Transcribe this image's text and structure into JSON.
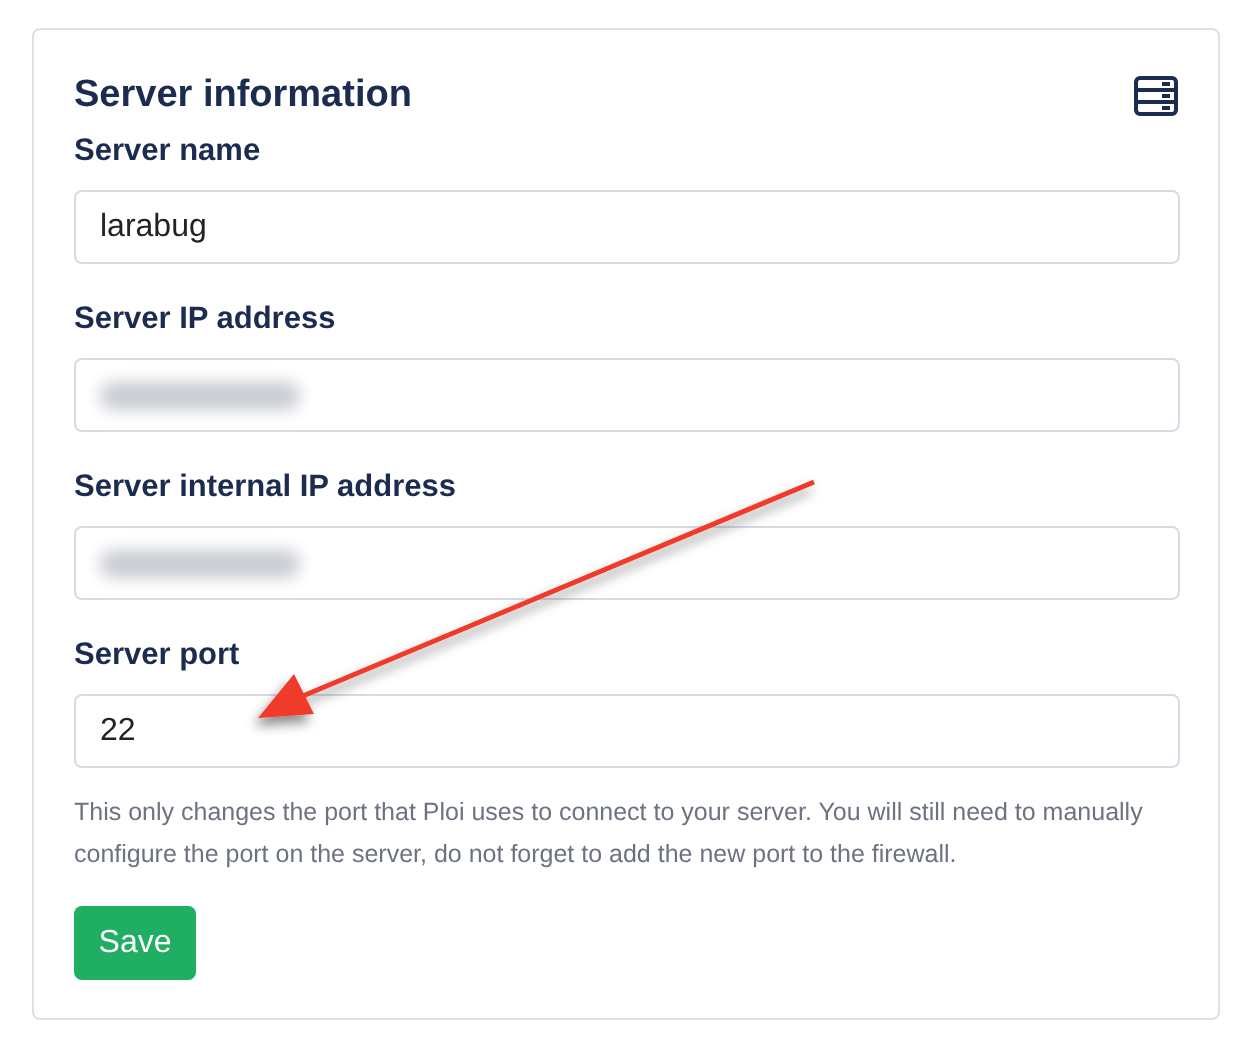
{
  "card": {
    "title": "Server information",
    "fields": [
      {
        "label": "Server name",
        "value": "larabug",
        "redacted": false
      },
      {
        "label": "Server IP address",
        "redacted": true
      },
      {
        "label": "Server internal IP address",
        "redacted": true
      },
      {
        "label": "Server port",
        "value": "22",
        "redacted": false
      }
    ],
    "help": "This only changes the port that Ploi uses to connect to your server. You will still need to manually configure the port on the server, do not forget to add the new port to the firewall.",
    "button": "Save"
  }
}
